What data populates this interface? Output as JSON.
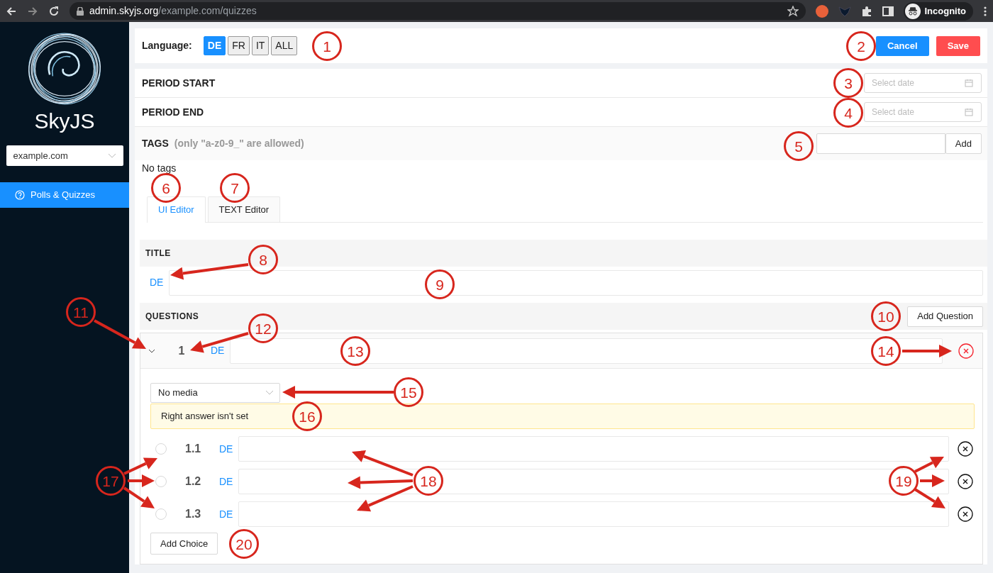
{
  "browser": {
    "url_host": "admin.skyjs.org",
    "url_path": "/example.com/quizzes",
    "profile": "Incognito"
  },
  "sidebar": {
    "brand": "SkyJS",
    "site_select": "example.com",
    "menu": [
      {
        "label": "Polls & Quizzes",
        "selected": true
      }
    ]
  },
  "toolbar": {
    "language_label": "Language:",
    "languages": [
      {
        "label": "DE",
        "selected": true
      },
      {
        "label": "FR",
        "selected": false
      },
      {
        "label": "IT",
        "selected": false
      },
      {
        "label": "ALL",
        "selected": false
      }
    ],
    "buttons": [
      {
        "label": "Cancel",
        "kind": "primary"
      },
      {
        "label": "Save",
        "kind": "danger"
      }
    ]
  },
  "period_start": {
    "label": "PERIOD START",
    "placeholder": "Select date"
  },
  "period_end": {
    "label": "PERIOD END",
    "placeholder": "Select date"
  },
  "tags": {
    "label": "TAGS",
    "hint": "(only \"a-z0-9_\" are allowed)",
    "add_button": "Add",
    "empty_text": "No tags"
  },
  "editor_tabs": [
    {
      "label": "UI Editor",
      "selected": true
    },
    {
      "label": "TEXT Editor",
      "selected": false
    }
  ],
  "title_section": {
    "heading": "TITLE",
    "lang": "DE"
  },
  "questions": {
    "heading": "QUESTIONS",
    "add_button": "Add Question",
    "items": [
      {
        "number": "1",
        "lang": "DE",
        "expanded": true,
        "media_select": "No media",
        "warning": "Right answer isn't set",
        "add_choice": "Add Choice",
        "choices": [
          {
            "number": "1.1",
            "lang": "DE",
            "selected": false
          },
          {
            "number": "1.2",
            "lang": "DE",
            "selected": false
          },
          {
            "number": "1.3",
            "lang": "DE",
            "selected": false
          }
        ]
      }
    ]
  },
  "annotations": [
    {
      "label": "1"
    },
    {
      "label": "2"
    },
    {
      "label": "3"
    },
    {
      "label": "4"
    },
    {
      "label": "5"
    },
    {
      "label": "6"
    },
    {
      "label": "7"
    },
    {
      "label": "8"
    },
    {
      "label": "9"
    },
    {
      "label": "10"
    },
    {
      "label": "11"
    },
    {
      "label": "12"
    },
    {
      "label": "13"
    },
    {
      "label": "14"
    },
    {
      "label": "15"
    },
    {
      "label": "16"
    },
    {
      "label": "17"
    },
    {
      "label": "18"
    },
    {
      "label": "19"
    },
    {
      "label": "20"
    }
  ]
}
